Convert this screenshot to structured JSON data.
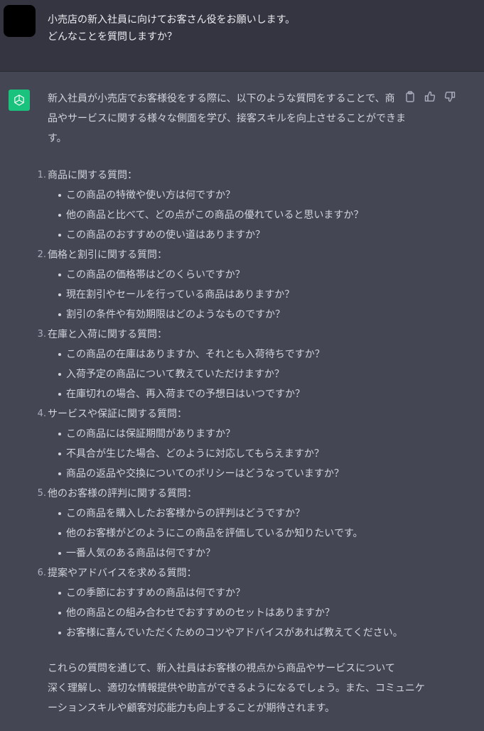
{
  "user_message": {
    "lines": [
      "小売店の新入社員に向けてお客さん役をお願いします。",
      "どんなことを質問しますか？"
    ]
  },
  "assistant_message": {
    "intro_lines": [
      "新入社員が小売店でお客様役をする際に、以下のような質問をすることで、商",
      "品やサービスに関する様々な側面を学び、接客スキルを向上させることができま",
      "す。"
    ],
    "sections": [
      {
        "number": "1.",
        "title": "商品に関する質問：",
        "items": [
          "この商品の特徴や使い方は何ですか？",
          "他の商品と比べて、どの点がこの商品の優れていると思いますか？",
          "この商品のおすすめの使い道はありますか？"
        ]
      },
      {
        "number": "2.",
        "title": "価格と割引に関する質問：",
        "items": [
          "この商品の価格帯はどのくらいですか？",
          "現在割引やセールを行っている商品はありますか？",
          "割引の条件や有効期限はどのようなものですか？"
        ]
      },
      {
        "number": "3.",
        "title": "在庫と入荷に関する質問：",
        "items": [
          "この商品の在庫はありますか、それとも入荷待ちですか？",
          "入荷予定の商品について教えていただけますか？",
          "在庫切れの場合、再入荷までの予想日はいつですか？"
        ]
      },
      {
        "number": "4.",
        "title": "サービスや保証に関する質問：",
        "items": [
          "この商品には保証期間がありますか？",
          "不具合が生じた場合、どのように対応してもらえますか？",
          "商品の返品や交換についてのポリシーはどうなっていますか？"
        ]
      },
      {
        "number": "5.",
        "title": "他のお客様の評判に関する質問：",
        "items": [
          "この商品を購入したお客様からの評判はどうですか？",
          "他のお客様がどのようにこの商品を評価しているか知りたいです。",
          "一番人気のある商品は何ですか？"
        ]
      },
      {
        "number": "6.",
        "title": "提案やアドバイスを求める質問：",
        "items": [
          "この季節におすすめの商品は何ですか？",
          "他の商品との組み合わせでおすすめのセットはありますか？",
          "お客様に喜んでいただくためのコツやアドバイスがあれば教えてください。"
        ]
      }
    ],
    "outro_lines": [
      "これらの質問を通じて、新入社員はお客様の視点から商品やサービスについて",
      "深く理解し、適切な情報提供や助言ができるようになるでしょう。また、コミュニケ",
      "ーションスキルや顧客対応能力も向上することが期待されます。"
    ]
  },
  "icons": {
    "assistant_avatar": "openai-logo-icon",
    "copy": "clipboard-icon",
    "like": "thumbs-up-icon",
    "dislike": "thumbs-down-icon"
  },
  "colors": {
    "user_bg": "#343541",
    "assistant_bg": "#444654",
    "assistant_avatar_bg": "#19c37d",
    "text": "#d1d5db"
  }
}
